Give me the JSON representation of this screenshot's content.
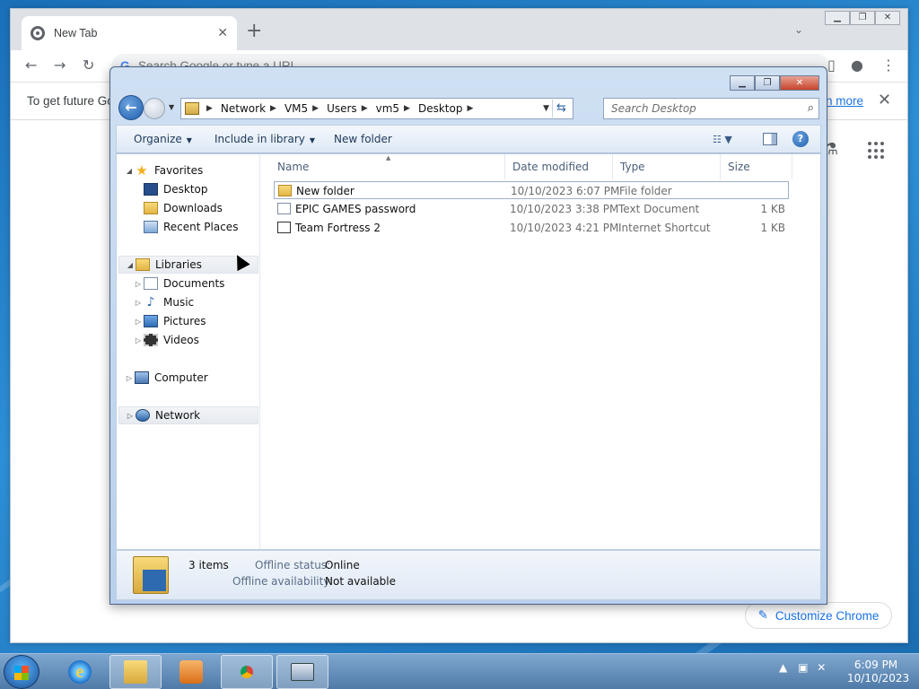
{
  "chrome": {
    "tab_title": "New Tab",
    "tab_close": "✕",
    "new_tab": "+",
    "omnibox_placeholder": "Search Google or type a URL",
    "infobar_text": "To get future Go",
    "infobar_link": "n more",
    "infobar_close": "✕",
    "customize_label": "Customize Chrome"
  },
  "explorer": {
    "breadcrumb": [
      "Network",
      "VM5",
      "Users",
      "vm5",
      "Desktop"
    ],
    "search_placeholder": "Search Desktop",
    "commands": {
      "organize": "Organize",
      "include_in_library": "Include in library",
      "new_folder": "New folder"
    },
    "nav": {
      "favorites": "Favorites",
      "desktop": "Desktop",
      "downloads": "Downloads",
      "recent_places": "Recent Places",
      "libraries": "Libraries",
      "documents": "Documents",
      "music": "Music",
      "pictures": "Pictures",
      "videos": "Videos",
      "computer": "Computer",
      "network": "Network"
    },
    "columns": {
      "name": "Name",
      "date_modified": "Date modified",
      "type": "Type",
      "size": "Size"
    },
    "files": [
      {
        "name": "New folder",
        "date": "10/10/2023 6:07 PM",
        "type": "File folder",
        "size": ""
      },
      {
        "name": "EPIC GAMES password",
        "date": "10/10/2023 3:38 PM",
        "type": "Text Document",
        "size": "1 KB"
      },
      {
        "name": "Team Fortress 2",
        "date": "10/10/2023 4:21 PM",
        "type": "Internet Shortcut",
        "size": "1 KB"
      }
    ],
    "details": {
      "item_count": "3 items",
      "offline_status_label": "Offline status:",
      "offline_status_value": "Online",
      "offline_availability_label": "Offline availability:",
      "offline_availability_value": "Not available"
    }
  },
  "taskbar": {
    "clock_time": "6:09 PM",
    "clock_date": "10/10/2023"
  }
}
